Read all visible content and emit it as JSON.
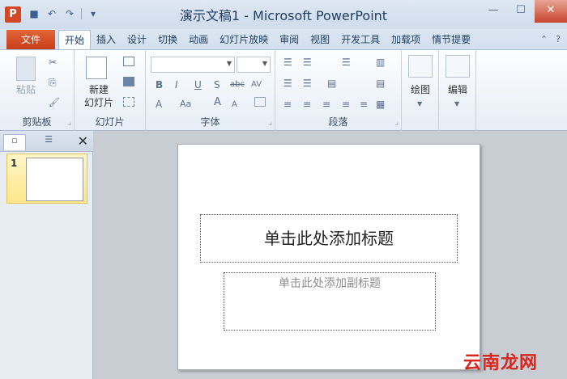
{
  "window": {
    "title": "演示文稿1 - Microsoft PowerPoint",
    "app_icon_letter": "P",
    "controls": {
      "minimize": "—",
      "maximize": "☐",
      "close": "✕"
    }
  },
  "quick_access": {
    "save": "■",
    "undo": "↶",
    "redo": "↷",
    "customize": "▾"
  },
  "tabs": {
    "file": "文件",
    "items": [
      "开始",
      "插入",
      "设计",
      "切换",
      "动画",
      "幻灯片放映",
      "审阅",
      "视图",
      "开发工具",
      "加载项",
      "情节提要"
    ],
    "active_index": 0,
    "collapse": "⌃",
    "help": "?"
  },
  "ribbon": {
    "clipboard": {
      "label": "剪贴板",
      "paste": "粘贴",
      "cut_icon": "✂",
      "copy_icon": "⎘",
      "format_painter_icon": "🖌"
    },
    "slides": {
      "label": "幻灯片",
      "new_slide_line1": "新建",
      "new_slide_line2": "幻灯片"
    },
    "font": {
      "label": "字体",
      "bold": "B",
      "italic": "I",
      "underline": "U",
      "shadow": "S",
      "strike": "abc",
      "spacing": "AV",
      "color": "A",
      "case": "Aa",
      "grow": "A",
      "shrink": "A"
    },
    "paragraph": {
      "label": "段落"
    },
    "drawing": {
      "label": "绘图"
    },
    "editing": {
      "label": "编辑"
    }
  },
  "slide_panel": {
    "tab_slides_icon": "▫",
    "tab_outline_icon": "☰",
    "close_icon": "✕",
    "thumbnail_number": "1"
  },
  "slide": {
    "title_placeholder": "单击此处添加标题",
    "subtitle_placeholder": "单击此处添加副标题"
  },
  "watermark": "云南龙网"
}
